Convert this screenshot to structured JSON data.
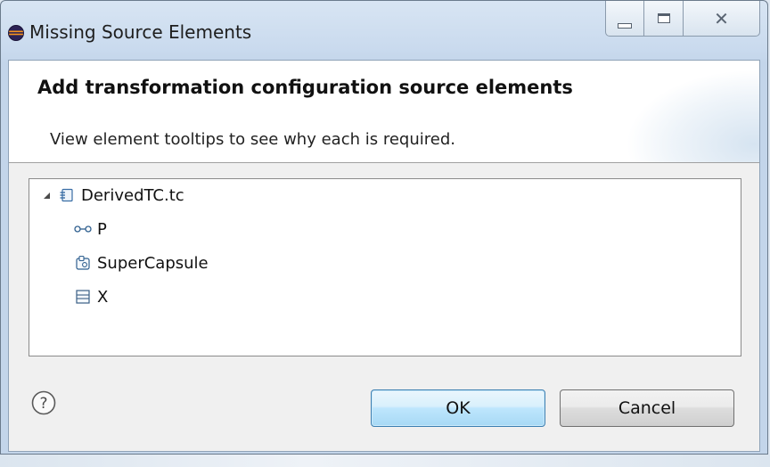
{
  "window": {
    "title": "Missing Source Elements",
    "icon": "eclipse-app-icon",
    "controls": [
      "minimize",
      "maximize",
      "close"
    ]
  },
  "banner": {
    "title": "Add transformation configuration source elements",
    "message": "View element tooltips to see why each is required."
  },
  "tree": {
    "root": {
      "label": "DerivedTC.tc",
      "icon": "transformation-config-icon",
      "expanded": true,
      "children": [
        {
          "label": "P",
          "icon": "port-icon"
        },
        {
          "label": "SuperCapsule",
          "icon": "capsule-icon"
        },
        {
          "label": "X",
          "icon": "class-icon"
        }
      ]
    }
  },
  "buttons": {
    "help_icon": "help-icon",
    "ok": "OK",
    "cancel": "Cancel"
  },
  "colors": {
    "titlebar": "#c9daee",
    "ok_button": "#bee6fd",
    "ok_border": "#3c7fb1"
  }
}
